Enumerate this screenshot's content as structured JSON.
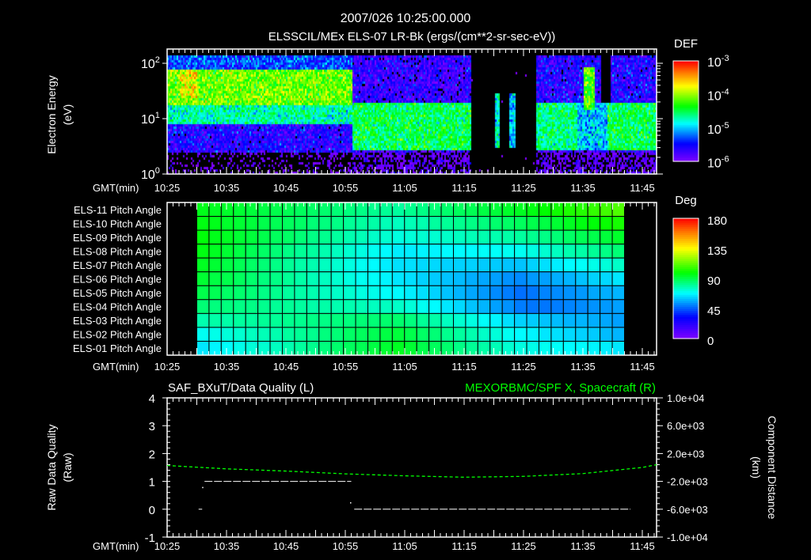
{
  "header": {
    "timestamp": "2007/026 10:25:00.000",
    "subtitle": "ELSSCIL/MEx ELS-07 LR-Bk  (ergs/(cm**2-sr-sec-eV))"
  },
  "time_axis": {
    "label": "GMT(min)",
    "ticks": [
      "10:25",
      "10:35",
      "10:45",
      "10:55",
      "11:05",
      "11:15",
      "11:25",
      "11:35",
      "11:45"
    ],
    "range_min": [
      0,
      82.4
    ]
  },
  "chart_data": [
    {
      "type": "heatmap",
      "name": "electron-spectrogram",
      "title": "ELSSCIL/MEx ELS-07 LR-Bk  (ergs/(cm**2-sr-sec-eV))",
      "ylabel": [
        "Electron Energy",
        "(eV)"
      ],
      "yscale": "log",
      "ylim": [
        1,
        180
      ],
      "yticks": [
        {
          "base": "10",
          "exp": "0",
          "value": 1
        },
        {
          "base": "10",
          "exp": "1",
          "value": 10
        },
        {
          "base": "10",
          "exp": "2",
          "value": 100
        }
      ],
      "colorbar": {
        "title": "DEF",
        "scale": "log",
        "range_log10": [
          -6,
          -3
        ],
        "labels": [
          {
            "base": "10",
            "exp": "-3"
          },
          {
            "base": "10",
            "exp": "-4"
          },
          {
            "base": "10",
            "exp": "-5"
          },
          {
            "base": "10",
            "exp": "-6"
          }
        ]
      },
      "background_log10_def": -5.8,
      "segments_note": "time in minutes after 10:25, energy in eV, level = log10 DEF",
      "segments": [
        {
          "t0": 0,
          "t1": 31,
          "e0": 1,
          "e1": 2.5,
          "level": -6.2
        },
        {
          "t0": 0,
          "t1": 31,
          "e0": 2.5,
          "e1": 8,
          "level": -5.6
        },
        {
          "t0": 0,
          "t1": 31,
          "e0": 8,
          "e1": 18,
          "level": -4.7
        },
        {
          "t0": 0,
          "t1": 31,
          "e0": 18,
          "e1": 80,
          "level": -4.1
        },
        {
          "t0": 2,
          "t1": 5,
          "e0": 25,
          "e1": 90,
          "level": -3.8
        },
        {
          "t0": 0,
          "t1": 31,
          "e0": 80,
          "e1": 180,
          "level": -5.3
        },
        {
          "t0": 31,
          "t1": 51,
          "e0": 1,
          "e1": 2.5,
          "level": -6.0
        },
        {
          "t0": 31,
          "t1": 51,
          "e0": 2.7,
          "e1": 20,
          "level": -4.5
        },
        {
          "t0": 31,
          "t1": 51,
          "e0": 20,
          "e1": 180,
          "level": -5.7
        },
        {
          "t0": 51,
          "t1": 62,
          "e0": 1,
          "e1": 180,
          "level": -6.6
        },
        {
          "t0": 55,
          "t1": 56,
          "e0": 3,
          "e1": 30,
          "level": -4.8
        },
        {
          "t0": 57.5,
          "t1": 58.5,
          "e0": 3,
          "e1": 30,
          "level": -5.0
        },
        {
          "t0": 62,
          "t1": 83,
          "e0": 1,
          "e1": 2.5,
          "level": -6.0
        },
        {
          "t0": 62,
          "t1": 69,
          "e0": 2.7,
          "e1": 20,
          "level": -4.6
        },
        {
          "t0": 62,
          "t1": 83,
          "e0": 20,
          "e1": 180,
          "level": -5.6
        },
        {
          "t0": 69,
          "t1": 74,
          "e0": 2.7,
          "e1": 20,
          "level": -5.0
        },
        {
          "t0": 70,
          "t1": 72,
          "e0": 15,
          "e1": 90,
          "level": -4.2
        },
        {
          "t0": 73,
          "t1": 74.5,
          "e0": 20,
          "e1": 180,
          "level": -6.6
        },
        {
          "t0": 74,
          "t1": 83,
          "e0": 2.7,
          "e1": 20,
          "level": -4.5
        }
      ]
    },
    {
      "type": "heatmap",
      "name": "pitch-angle-grid",
      "rows": [
        "ELS-11 Pitch Angle",
        "ELS-10 Pitch Angle",
        "ELS-09 Pitch Angle",
        "ELS-08 Pitch Angle",
        "ELS-07 Pitch Angle",
        "ELS-06 Pitch Angle",
        "ELS-05 Pitch Angle",
        "ELS-04 Pitch Angle",
        "ELS-03 Pitch Angle",
        "ELS-02 Pitch Angle",
        "ELS-01 Pitch Angle"
      ],
      "time_range_min": [
        5,
        77
      ],
      "colorbar": {
        "title": "Deg",
        "range": [
          0,
          180
        ],
        "labels": [
          "180",
          "135",
          "90",
          "45",
          "0"
        ]
      },
      "values_deg": [
        [
          96,
          95,
          94,
          93,
          92,
          91,
          90,
          89,
          88,
          87,
          86,
          85,
          84,
          83,
          82,
          81,
          80,
          82,
          83,
          85,
          86,
          88,
          89,
          91,
          92,
          94,
          95,
          97,
          99,
          101,
          103,
          104,
          106,
          108,
          110
        ],
        [
          97,
          96,
          94,
          93,
          92,
          90,
          89,
          88,
          87,
          85,
          84,
          83,
          81,
          80,
          79,
          77,
          76,
          77,
          78,
          80,
          81,
          82,
          83,
          84,
          86,
          87,
          88,
          90,
          91,
          93,
          95,
          97,
          98,
          100,
          102
        ],
        [
          98,
          96,
          95,
          93,
          92,
          90,
          88,
          87,
          85,
          83,
          82,
          80,
          78,
          77,
          75,
          74,
          72,
          73,
          74,
          74,
          75,
          76,
          77,
          78,
          78,
          79,
          80,
          82,
          83,
          85,
          87,
          89,
          90,
          92,
          94
        ],
        [
          97,
          95,
          93,
          91,
          89,
          87,
          85,
          83,
          81,
          80,
          78,
          76,
          74,
          72,
          70,
          68,
          66,
          66,
          67,
          67,
          68,
          68,
          68,
          69,
          69,
          70,
          70,
          72,
          74,
          76,
          78,
          79,
          81,
          83,
          85
        ],
        [
          95,
          93,
          91,
          89,
          87,
          85,
          83,
          81,
          79,
          78,
          76,
          74,
          72,
          70,
          68,
          66,
          64,
          64,
          63,
          63,
          62,
          62,
          62,
          61,
          61,
          60,
          60,
          62,
          64,
          66,
          68,
          69,
          71,
          73,
          75
        ],
        [
          93,
          91,
          90,
          88,
          86,
          84,
          83,
          81,
          79,
          77,
          76,
          74,
          72,
          70,
          69,
          67,
          65,
          64,
          62,
          61,
          60,
          59,
          57,
          56,
          55,
          53,
          52,
          54,
          55,
          57,
          58,
          60,
          62,
          63,
          65
        ],
        [
          90,
          89,
          87,
          86,
          85,
          83,
          82,
          80,
          79,
          78,
          76,
          75,
          74,
          72,
          71,
          69,
          68,
          66,
          64,
          62,
          60,
          58,
          56,
          54,
          52,
          50,
          48,
          49,
          51,
          52,
          53,
          54,
          56,
          57,
          58
        ],
        [
          85,
          84,
          84,
          83,
          83,
          82,
          81,
          81,
          80,
          79,
          79,
          78,
          78,
          77,
          76,
          76,
          75,
          73,
          70,
          68,
          65,
          63,
          60,
          58,
          55,
          53,
          50,
          49,
          49,
          50,
          51,
          52,
          53,
          54,
          55
        ],
        [
          78,
          79,
          79,
          80,
          80,
          81,
          81,
          82,
          82,
          83,
          83,
          84,
          84,
          85,
          85,
          86,
          86,
          84,
          81,
          79,
          76,
          74,
          72,
          69,
          67,
          64,
          62,
          61,
          60,
          59,
          58,
          58,
          57,
          56,
          55
        ],
        [
          70,
          71,
          73,
          74,
          76,
          77,
          78,
          80,
          81,
          82,
          84,
          85,
          87,
          88,
          89,
          91,
          92,
          90,
          87,
          85,
          82,
          80,
          78,
          75,
          73,
          70,
          68,
          67,
          65,
          64,
          63,
          62,
          61,
          59,
          58
        ],
        [
          65,
          67,
          69,
          71,
          73,
          74,
          76,
          78,
          80,
          82,
          84,
          86,
          88,
          89,
          91,
          93,
          95,
          93,
          90,
          88,
          86,
          83,
          81,
          79,
          77,
          74,
          72,
          71,
          70,
          69,
          68,
          68,
          67,
          66,
          65
        ]
      ]
    },
    {
      "type": "line",
      "name": "data-quality-and-position",
      "left_title": "SAF_BXuT/Data Quality (L)",
      "right_title": "MEXORBMC/SPF X, Spacecraft (R)",
      "ylabel_left": [
        "Raw Data Quality",
        "(Raw)"
      ],
      "ylabel_right": [
        "Component Distance",
        "(km)"
      ],
      "ylim_left": [
        -1,
        4
      ],
      "yticks_left": [
        "4",
        "3",
        "2",
        "1",
        "0",
        "-1"
      ],
      "ylim_right": [
        -10000,
        10000
      ],
      "yticks_right": [
        "1.0e+04",
        "6.0e+03",
        "2.0e+03",
        "-2.0e+03",
        "-6.0e+03",
        "-1.0e+04"
      ],
      "series": [
        {
          "name": "Data Quality",
          "color": "#ffffff",
          "segments": [
            {
              "t0": 5.3,
              "t1": 5.9,
              "value": 0
            },
            {
              "t0": 6.3,
              "t1": 31,
              "value": 1
            },
            {
              "t0": 31.5,
              "t1": 78,
              "value": 0
            }
          ],
          "points": [
            {
              "t": 5.9,
              "value": 0.8
            },
            {
              "t": 30.8,
              "value": 0.25
            }
          ]
        },
        {
          "name": "SPF X, Spacecraft",
          "color": "#00ff00",
          "t": [
            0,
            10,
            20,
            30,
            40,
            50,
            60,
            70,
            80,
            82.4
          ],
          "km": [
            280,
            -200,
            -520,
            -920,
            -1200,
            -1400,
            -1280,
            -880,
            0,
            400
          ]
        }
      ]
    }
  ]
}
